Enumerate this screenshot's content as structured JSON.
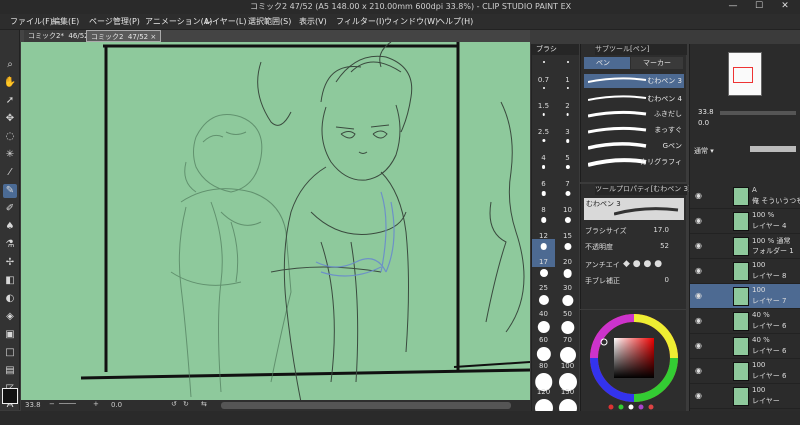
{
  "window": {
    "title": "コミック2 47/52 (A5 148.00 x 210.00mm 600dpi 33.8%) - CLIP STUDIO PAINT EX"
  },
  "menu": [
    "ファイル(F)",
    "編集(E)",
    "ページ管理(P)",
    "アニメーション(A)",
    "レイヤー(L)",
    "選択範囲(S)",
    "表示(V)",
    "フィルター(I)",
    "ウィンドウ(W)",
    "ヘルプ(H)"
  ],
  "doc_tabs": [
    {
      "label": "コミック2*",
      "page": "46/52"
    },
    {
      "label": "コミック2",
      "page": "47/52"
    }
  ],
  "status": {
    "zoom": "33.8",
    "angle": "0.0"
  },
  "brush_sizes": [
    "0.7",
    "1",
    "1.5",
    "2",
    "2.5",
    "3",
    "4",
    "5",
    "6",
    "7",
    "8",
    "10",
    "12",
    "15",
    "17",
    "20",
    "25",
    "30",
    "40",
    "50",
    "60",
    "70",
    "80",
    "100",
    "120",
    "150",
    "170",
    "200"
  ],
  "selected_brush_size": "17",
  "size_panel_tab": "ブラシ",
  "subtool_panel": {
    "tab": "サブツール[ペン]",
    "tabs": [
      "ペン",
      "マーカー"
    ],
    "brushes": [
      "むわペン 3",
      "むわペン 4",
      "ふきだし",
      "まっすぐ",
      "Gペン",
      "カリグラフィ"
    ]
  },
  "tool_property": {
    "tab": "ツールプロパティ[むわペン 3]",
    "brush_name": "むわペン 3",
    "rows": [
      {
        "label": "ブラシサイズ",
        "value": "17.0"
      },
      {
        "label": "不透明度",
        "value": "52"
      },
      {
        "label": "アンチエイ",
        "value": ""
      },
      {
        "label": "手ブレ補正",
        "value": "0"
      }
    ]
  },
  "layer_panel": {
    "blend": "通常",
    "layers": [
      {
        "t1": "A",
        "t2": "俺 そういうつも",
        "sel": false
      },
      {
        "t1": "100 %",
        "t2": "レイヤー 4",
        "sel": false
      },
      {
        "t1": "100 % 通常",
        "t2": "フォルダー 1",
        "sel": false
      },
      {
        "t1": "100",
        "t2": "レイヤー 8",
        "sel": false
      },
      {
        "t1": "100",
        "t2": "レイヤー 7",
        "sel": true
      },
      {
        "t1": "40 %",
        "t2": "レイヤー 6",
        "sel": false
      },
      {
        "t1": "40 %",
        "t2": "レイヤー 6",
        "sel": false
      },
      {
        "t1": "100",
        "t2": "レイヤー 6",
        "sel": false
      },
      {
        "t1": "100",
        "t2": "レイヤー",
        "sel": false
      }
    ]
  },
  "nav": {
    "zoom": "33.8"
  },
  "colors": {
    "canvas": "#8ec99c",
    "accent": "#4d6a92"
  }
}
